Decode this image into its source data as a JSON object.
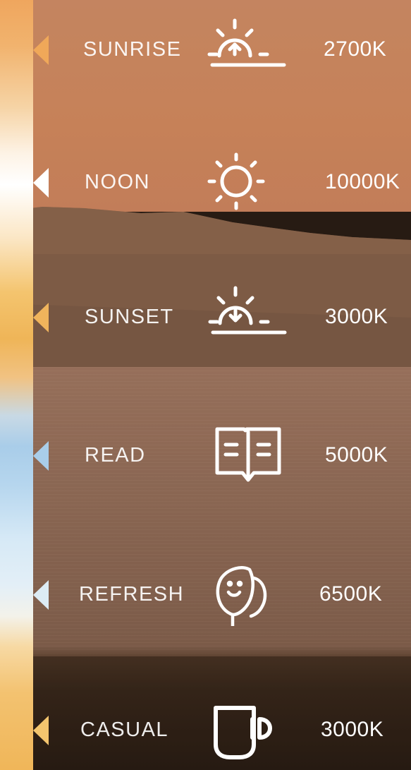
{
  "colors": {
    "strip_warm": "#efa65e",
    "strip_white": "#ffffff",
    "strip_cool": "#a9cde9",
    "marker_sunrise": "#f0a859",
    "marker_noon": "#ffffff",
    "marker_sunset": "#f0b45c",
    "marker_read": "#a9cde9",
    "marker_refresh": "#dcebf4",
    "marker_casual": "#f3c56e",
    "text": "#ffffff"
  },
  "modes": [
    {
      "label": "SUNRISE",
      "icon": "sunrise-icon",
      "value": "2700K"
    },
    {
      "label": "NOON",
      "icon": "sun-icon",
      "value": "10000K"
    },
    {
      "label": "SUNSET",
      "icon": "sunset-icon",
      "value": "3000K"
    },
    {
      "label": "READ",
      "icon": "open-book-icon",
      "value": "5000K"
    },
    {
      "label": "REFRESH",
      "icon": "leaf-icon",
      "value": "6500K"
    },
    {
      "label": "CASUAL",
      "icon": "coffee-cup-icon",
      "value": "3000K"
    }
  ]
}
